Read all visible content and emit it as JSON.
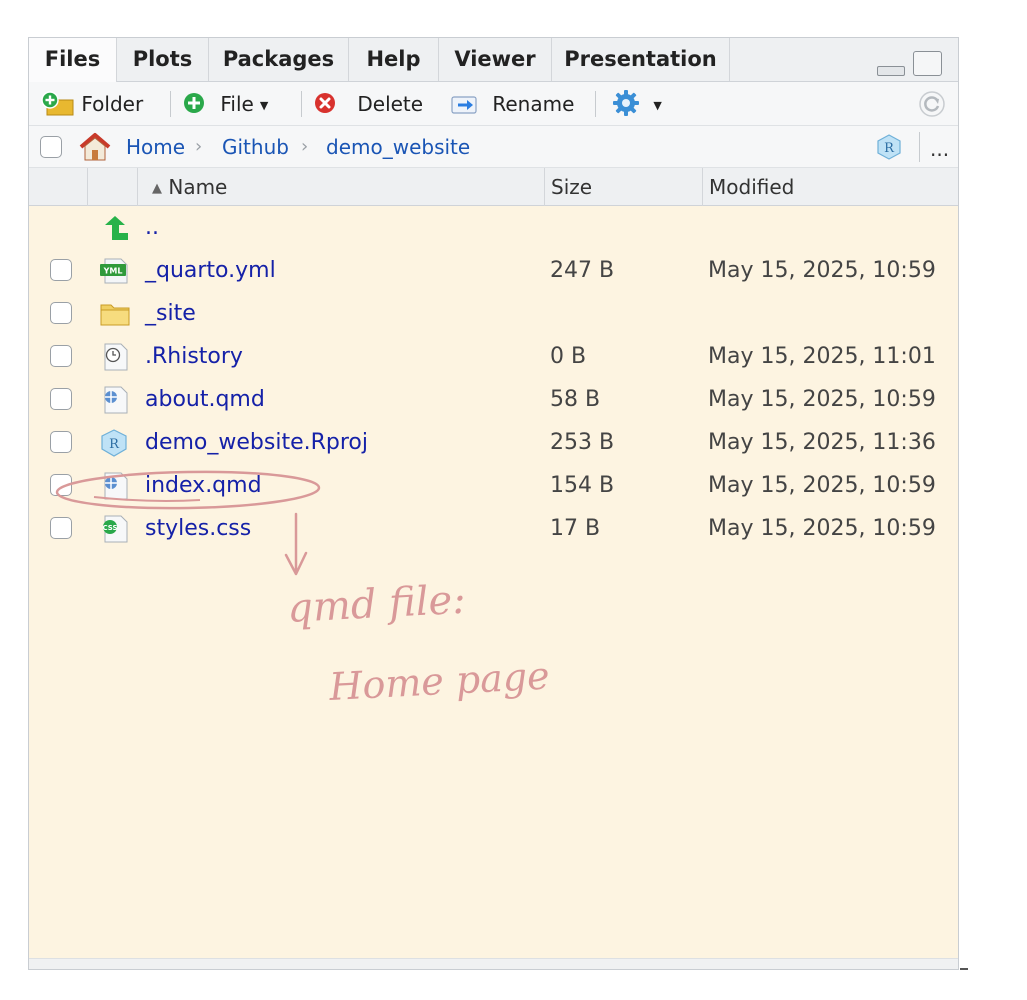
{
  "tabs": [
    {
      "label": "Files"
    },
    {
      "label": "Plots"
    },
    {
      "label": "Packages"
    },
    {
      "label": "Help"
    },
    {
      "label": "Viewer"
    },
    {
      "label": "Presentation"
    }
  ],
  "toolbar": {
    "new_folder_label": "Folder",
    "new_file_label": "File",
    "delete_label": "Delete",
    "rename_label": "Rename"
  },
  "breadcrumb": {
    "items": [
      "Home",
      "Github",
      "demo_website"
    ],
    "more_label": "..."
  },
  "columns": {
    "name": "Name",
    "size": "Size",
    "modified": "Modified"
  },
  "files": [
    {
      "name": "..",
      "size": "",
      "modified": "",
      "icon": "parent-directory-icon"
    },
    {
      "name": "_quarto.yml",
      "size": "247 B",
      "modified": "May 15, 2025, 10:59",
      "icon": "yml-file-icon"
    },
    {
      "name": "_site",
      "size": "",
      "modified": "",
      "icon": "folder-icon"
    },
    {
      "name": ".Rhistory",
      "size": "0 B",
      "modified": "May 15, 2025, 11:01",
      "icon": "history-file-icon"
    },
    {
      "name": "about.qmd",
      "size": "58 B",
      "modified": "May 15, 2025, 10:59",
      "icon": "quarto-file-icon"
    },
    {
      "name": "demo_website.Rproj",
      "size": "253 B",
      "modified": "May 15, 2025, 11:36",
      "icon": "rproj-file-icon"
    },
    {
      "name": "index.qmd",
      "size": "154 B",
      "modified": "May 15, 2025, 10:59",
      "icon": "quarto-file-icon"
    },
    {
      "name": "styles.css",
      "size": "17 B",
      "modified": "May 15, 2025, 10:59",
      "icon": "css-file-icon"
    }
  ],
  "annotation": {
    "line1": "qmd file:",
    "line2": "Home page"
  },
  "colors": {
    "file_link": "#1521a8",
    "crumb_link": "#1a55b5",
    "list_background": "#fdf4e1",
    "annotation_ink": "#d99999"
  }
}
